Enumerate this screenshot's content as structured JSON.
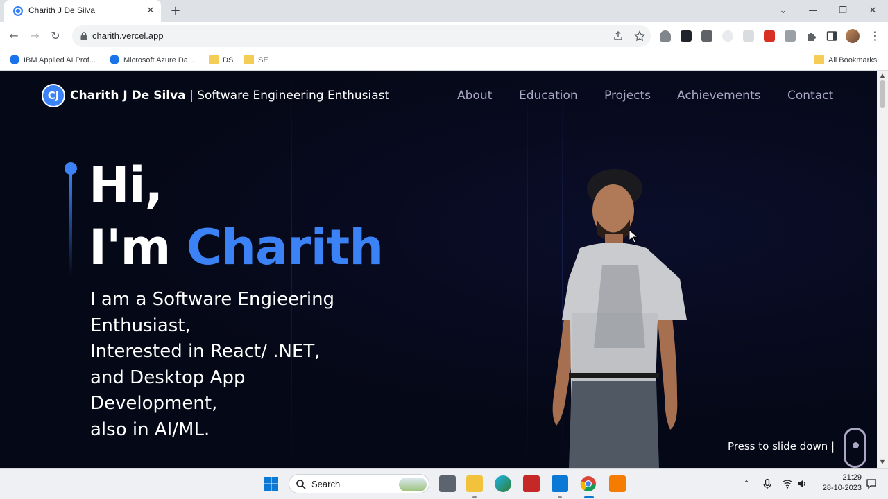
{
  "browser": {
    "tab_title": "Charith J De Silva",
    "new_tab_label": "+",
    "url": "charith.vercel.app",
    "bookmarks": [
      "IBM Applied AI Prof...",
      "Microsoft Azure Da...",
      "DS",
      "SE"
    ],
    "all_bookmarks_label": "All Bookmarks"
  },
  "site": {
    "logo_initials": "CJ",
    "brand_name": "Charith J De Silva",
    "brand_tagline": " | Software Engineering Enthusiast",
    "nav": [
      "About",
      "Education",
      "Projects",
      "Achievements",
      "Contact"
    ],
    "hero_greeting": "Hi,",
    "hero_prefix": "I'm ",
    "hero_name": "Charith",
    "intro_lines": [
      "I am a Software Engieering",
      "Enthusiast,",
      "Interested in React/ .NET,",
      "and Desktop App",
      "Development,",
      "also in AI/ML."
    ],
    "scroll_prompt": "Press to slide down  |"
  },
  "taskbar": {
    "search_placeholder": "Search",
    "time": "21:29",
    "date": "28-10-2023"
  },
  "colors": {
    "background": "#050816",
    "accent": "#3b82f6",
    "nav_text": "#aaa6c3"
  }
}
